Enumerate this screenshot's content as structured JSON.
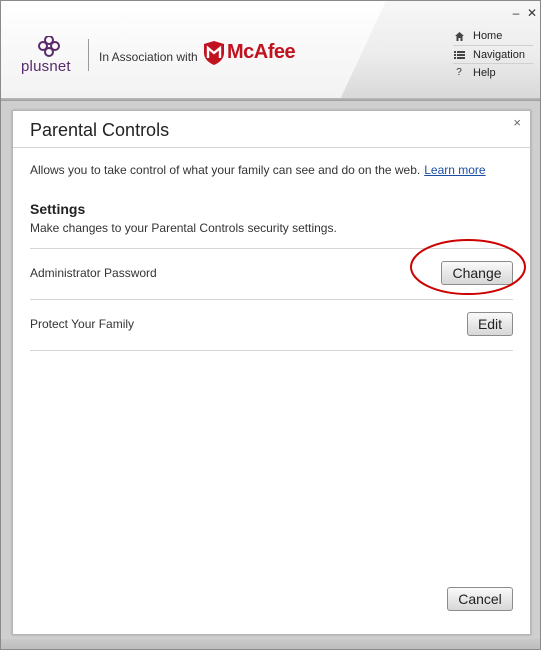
{
  "window": {
    "minimize": "–",
    "close": "✕"
  },
  "header": {
    "brand": "plusnet",
    "association": "In Association with",
    "partner": "McAfee",
    "nav": [
      {
        "label": "Home",
        "icon": "home-icon"
      },
      {
        "label": "Navigation",
        "icon": "list-icon"
      },
      {
        "label": "Help",
        "icon": "help-icon"
      }
    ]
  },
  "dialog": {
    "title": "Parental Controls",
    "close": "×",
    "intro": "Allows you to take control of what your family can see and do on the web.",
    "learn_more": "Learn more",
    "settings_heading": "Settings",
    "settings_sub": "Make changes to your Parental Controls security settings.",
    "rows": [
      {
        "label": "Administrator Password",
        "button": "Change"
      },
      {
        "label": "Protect Your Family",
        "button": "Edit"
      }
    ],
    "cancel": "Cancel"
  },
  "colors": {
    "plusnet_purple": "#5a2a6c",
    "mcafee_red": "#c1121f",
    "link_blue": "#1a4fa3",
    "annotation_red": "#cc0000"
  }
}
